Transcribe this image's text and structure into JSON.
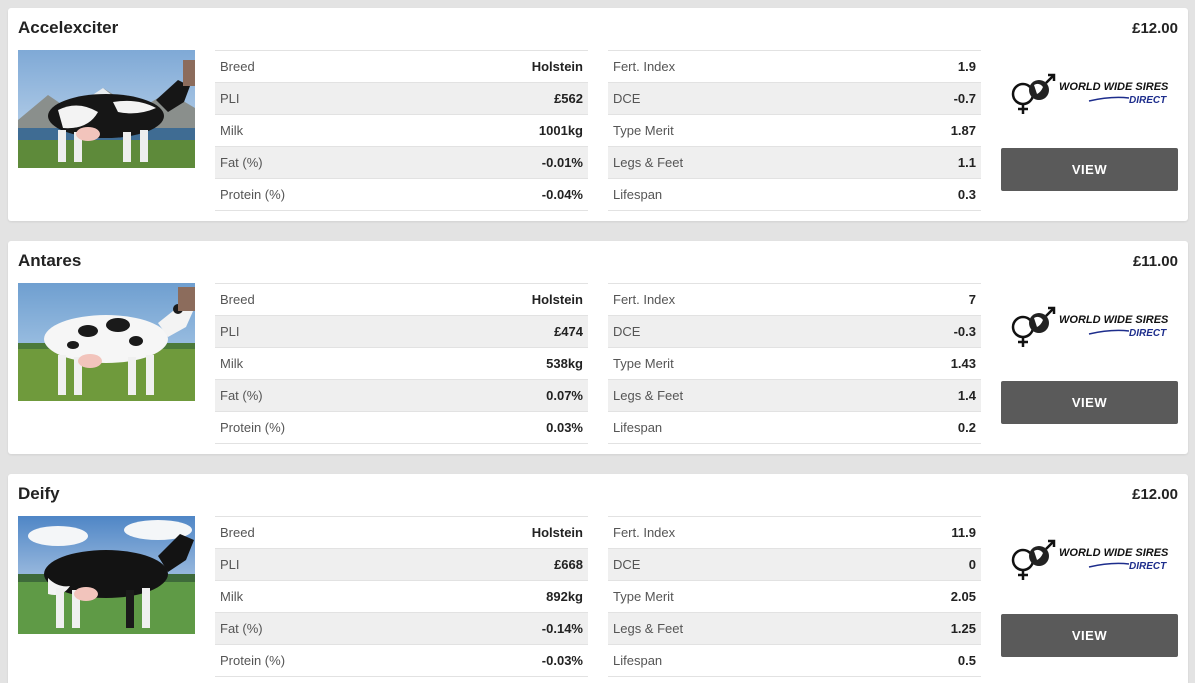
{
  "listings": [
    {
      "name": "Accelexciter",
      "price": "£12.00",
      "photo": "black-and-white holstein cow, side view, mountain lake background",
      "left_table": [
        {
          "label": "Breed",
          "value": "Holstein"
        },
        {
          "label": "PLI",
          "value": "£562"
        },
        {
          "label": "Milk",
          "value": "1001kg"
        },
        {
          "label": "Fat (%)",
          "value": "-0.01%"
        },
        {
          "label": "Protein (%)",
          "value": "-0.04%"
        }
      ],
      "right_table": [
        {
          "label": "Fert. Index",
          "value": "1.9"
        },
        {
          "label": "DCE",
          "value": "-0.7"
        },
        {
          "label": "Type Merit",
          "value": "1.87"
        },
        {
          "label": "Legs & Feet",
          "value": "1.1"
        },
        {
          "label": "Lifespan",
          "value": "0.3"
        }
      ],
      "logo": {
        "line1": "WORLD WIDE SIRES",
        "line2": "DIRECT"
      },
      "button": "VIEW"
    },
    {
      "name": "Antares",
      "price": "£11.00",
      "photo": "mostly white holstein cow with black spots, green field",
      "left_table": [
        {
          "label": "Breed",
          "value": "Holstein"
        },
        {
          "label": "PLI",
          "value": "£474"
        },
        {
          "label": "Milk",
          "value": "538kg"
        },
        {
          "label": "Fat (%)",
          "value": "0.07%"
        },
        {
          "label": "Protein (%)",
          "value": "0.03%"
        }
      ],
      "right_table": [
        {
          "label": "Fert. Index",
          "value": "7"
        },
        {
          "label": "DCE",
          "value": "-0.3"
        },
        {
          "label": "Type Merit",
          "value": "1.43"
        },
        {
          "label": "Legs & Feet",
          "value": "1.4"
        },
        {
          "label": "Lifespan",
          "value": "0.2"
        }
      ],
      "logo": {
        "line1": "WORLD WIDE SIRES",
        "line2": "DIRECT"
      },
      "button": "VIEW"
    },
    {
      "name": "Deify",
      "price": "£12.00",
      "photo": "mostly black holstein cow, green field with trees",
      "left_table": [
        {
          "label": "Breed",
          "value": "Holstein"
        },
        {
          "label": "PLI",
          "value": "£668"
        },
        {
          "label": "Milk",
          "value": "892kg"
        },
        {
          "label": "Fat (%)",
          "value": "-0.14%"
        },
        {
          "label": "Protein (%)",
          "value": "-0.03%"
        }
      ],
      "right_table": [
        {
          "label": "Fert. Index",
          "value": "11.9"
        },
        {
          "label": "DCE",
          "value": "0"
        },
        {
          "label": "Type Merit",
          "value": "2.05"
        },
        {
          "label": "Legs & Feet",
          "value": "1.25"
        },
        {
          "label": "Lifespan",
          "value": "0.5"
        }
      ],
      "logo": {
        "line1": "WORLD WIDE SIRES",
        "line2": "DIRECT"
      },
      "button": "VIEW"
    }
  ],
  "colors": {
    "page_bg": "#e3e3e3",
    "button_bg": "#5a5a5a",
    "logo_blue": "#1d2d8c"
  }
}
